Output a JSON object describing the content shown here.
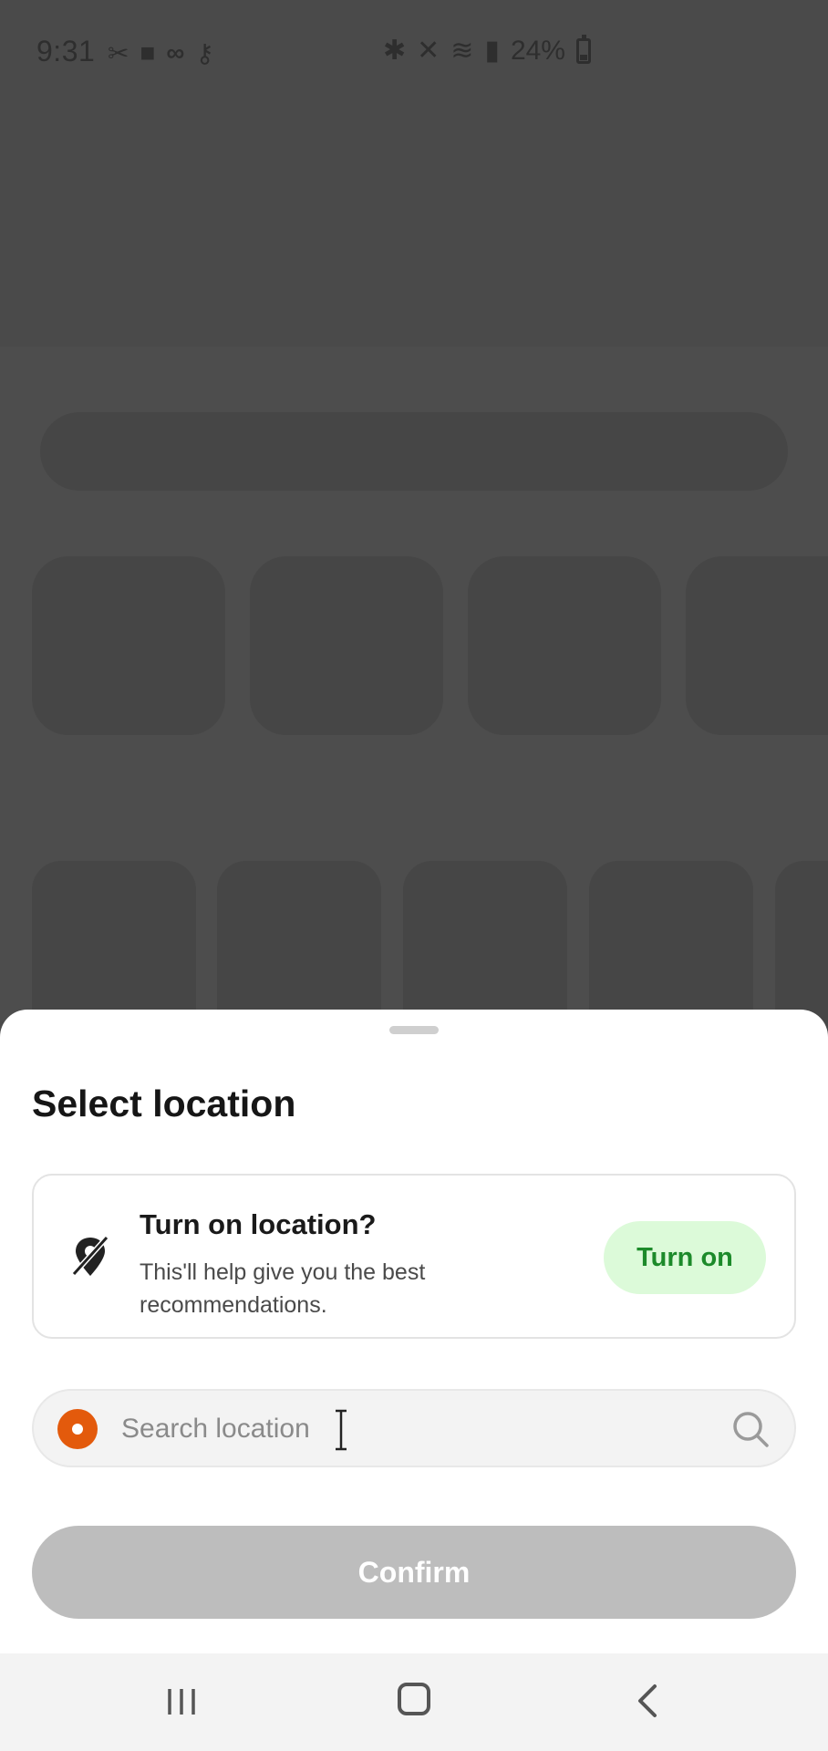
{
  "status_bar": {
    "time": "9:31",
    "battery": "24%"
  },
  "sheet": {
    "title": "Select location",
    "location_prompt": {
      "heading": "Turn on location?",
      "description": "This'll help give you the best recommendations.",
      "button_label": "Turn on"
    },
    "search": {
      "placeholder": "Search location"
    },
    "confirm_label": "Confirm"
  },
  "colors": {
    "accent_green_text": "#1c8a2a",
    "accent_green_bg": "#dcfad9",
    "location_dot": "#e35a0c",
    "confirm_disabled": "#bdbdbd"
  },
  "icons": {
    "location_off": "location-off-icon",
    "search": "search-icon",
    "nav_recents": "recents-icon",
    "nav_home": "home-icon",
    "nav_back": "back-icon"
  }
}
